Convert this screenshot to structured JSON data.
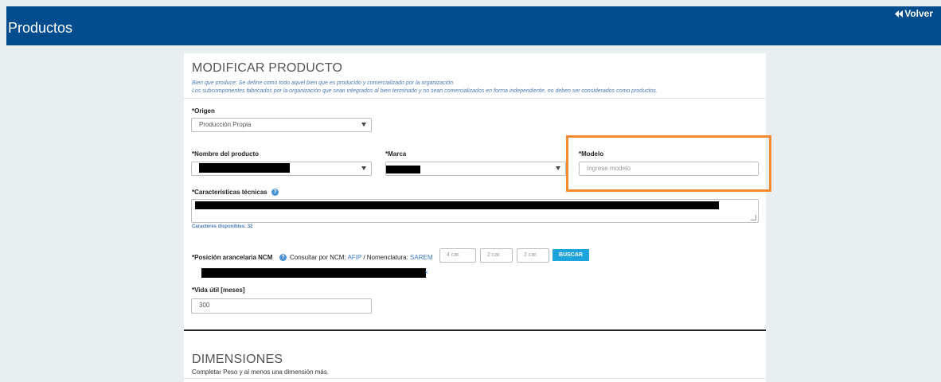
{
  "header": {
    "title": "Productos",
    "back_label": "Volver",
    "back_icon": "double-chevron-left-icon",
    "color": "#004c8d"
  },
  "form": {
    "section_title": "MODIFICAR PRODUCTO",
    "info_line_1": "Bien que produce: Se define como todo aquel bien que es producido y comercializado por la organización.",
    "info_line_2": "Los subcomponentes fabricados por la organización que sean integrados al bien terminado y no sean comercializados en forma independiente, no deben ser considerados como productos.",
    "origen": {
      "label": "*Origen",
      "value": "Producción Propia"
    },
    "nombre": {
      "label": "*Nombre del producto",
      "value": ""
    },
    "marca": {
      "label": "*Marca",
      "value": ""
    },
    "modelo": {
      "label": "*Modelo",
      "placeholder": "Ingrese modelo",
      "value": ""
    },
    "caracteristicas": {
      "label": "*Características técnicas",
      "available": "Caracteres disponibles: 32"
    },
    "ncm": {
      "label": "*Posición arancelaria NCM",
      "consult_text": "Consultar por NCM:",
      "link_afip": "AFIP",
      "separator": " / Nomenclatura:",
      "link_sarem": "SAREM",
      "box1_placeholder": "4 car.",
      "box2_placeholder": "2 car.",
      "box3_placeholder": "2 car.",
      "search_button": "BUSCAR",
      "clear_icon": "close-icon"
    },
    "vida_util": {
      "label": "*Vida útil [meses]",
      "value": "300"
    }
  },
  "dimensions": {
    "title": "DIMENSIONES",
    "subtitle": "Completar Peso y al menos una dimensión más."
  },
  "colors": {
    "accent": "#1ea4dc",
    "highlight": "#f58a2e",
    "link": "#3a78c2"
  }
}
